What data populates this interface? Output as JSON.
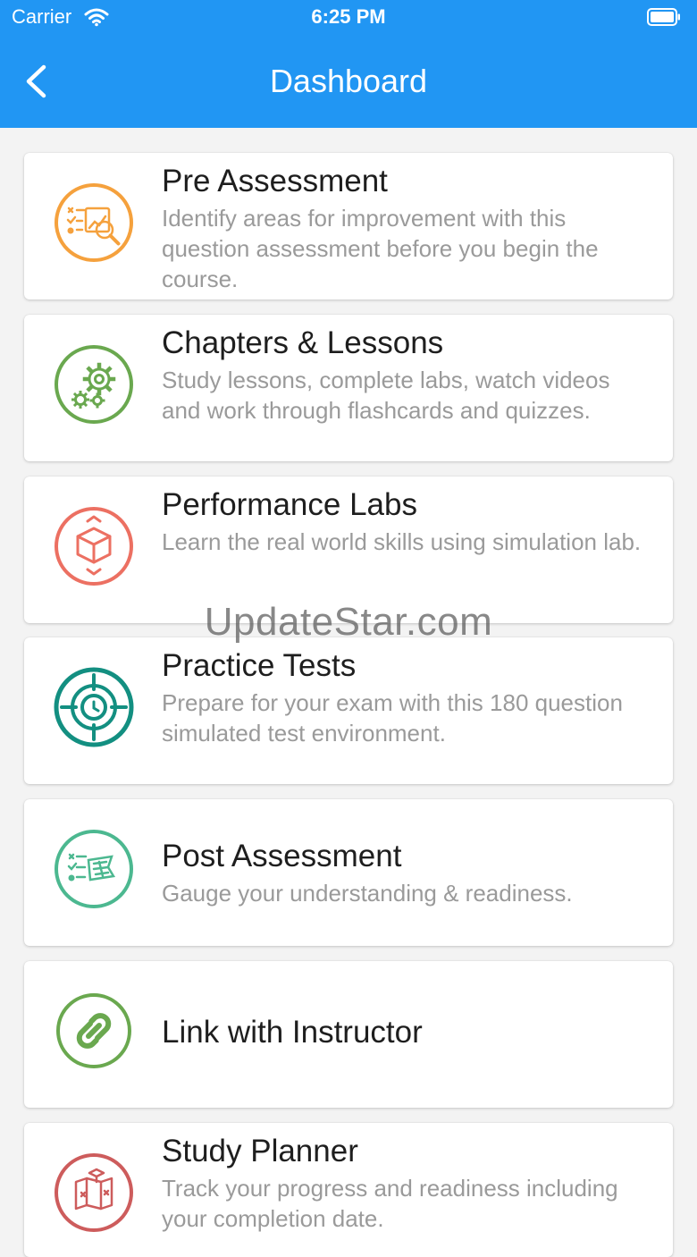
{
  "status_bar": {
    "carrier": "Carrier",
    "time": "6:25 PM"
  },
  "header": {
    "title": "Dashboard"
  },
  "watermark": "UpdateStar.com",
  "cards": [
    {
      "title": "Pre Assessment",
      "description": "Identify areas for improvement with this question assessment before you begin the course.",
      "icon": "assessment-search-icon",
      "color": "#f5a13d"
    },
    {
      "title": "Chapters & Lessons",
      "description": "Study lessons, complete labs, watch videos and work through flashcards and quizzes.",
      "icon": "gears-icon",
      "color": "#6aa84f"
    },
    {
      "title": "Performance Labs",
      "description": "Learn the real world skills using simulation lab.",
      "icon": "cube-icon",
      "color": "#ec7062"
    },
    {
      "title": "Practice Tests",
      "description": "Prepare for your exam with this 180 question simulated test environment.",
      "icon": "target-icon",
      "color": "#138f81"
    },
    {
      "title": "Post Assessment",
      "description": "Gauge your understanding & readiness.",
      "icon": "checklist-flag-icon",
      "color": "#4cb890"
    },
    {
      "title": "Link with Instructor",
      "description": "",
      "icon": "link-icon",
      "color": "#6aa84f"
    },
    {
      "title": "Study Planner",
      "description": "Track your progress and readiness including your completion date.",
      "icon": "planner-icon",
      "color": "#cd5c5c"
    }
  ],
  "colors": {
    "header_bg": "#2196f3",
    "page_bg": "#f3f3f3"
  }
}
